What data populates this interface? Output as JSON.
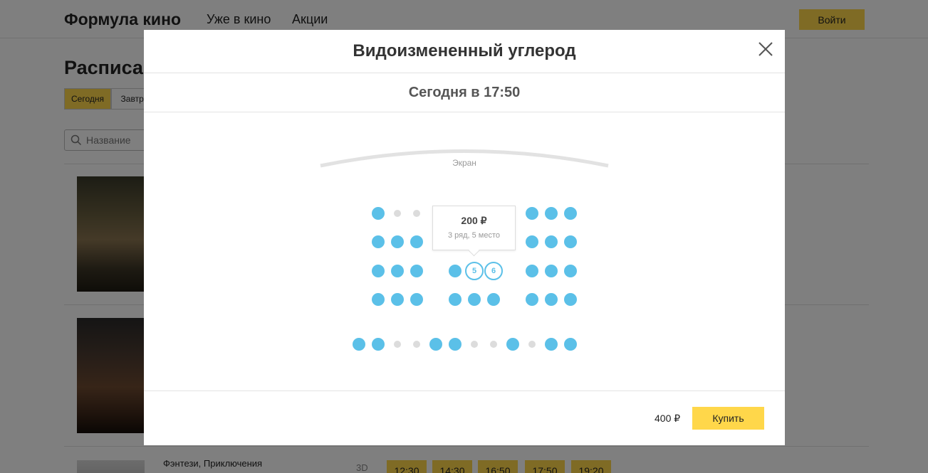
{
  "header": {
    "logo": "Формула кино",
    "nav": [
      "Уже в кино",
      "Акции"
    ],
    "login_label": "Войти"
  },
  "schedule": {
    "title": "Расписание",
    "day_tabs": [
      "Сегодня",
      "Завтра"
    ],
    "search_placeholder": "Название",
    "genre": "Фэнтези, Приключения",
    "format": "3D",
    "times": [
      "12:30",
      "14:30",
      "16:50",
      "17:50",
      "19:20"
    ]
  },
  "modal": {
    "title": "Видоизмененный углерод",
    "session": "Сегодня в 17:50",
    "screen_label": "Экран",
    "rows": [
      [
        "free",
        "taken",
        "taken",
        "gap",
        "free",
        "free",
        "free",
        "gap",
        "free",
        "free",
        "free"
      ],
      [
        "free",
        "free",
        "free",
        "gap",
        "free",
        "free",
        "free",
        "gap",
        "free",
        "free",
        "free"
      ],
      [
        "free",
        "free",
        "free",
        "gap",
        "free",
        "selected",
        "selected",
        "gap",
        "free",
        "free",
        "free"
      ],
      [
        "free",
        "free",
        "free",
        "gap",
        "free",
        "free",
        "free",
        "gap",
        "free",
        "free",
        "free"
      ],
      [
        "free",
        "free",
        "taken",
        "taken",
        "free",
        "free",
        "taken",
        "taken",
        "free",
        "taken",
        "free",
        "free"
      ]
    ],
    "selected_labels": [
      "5",
      "6"
    ],
    "tooltip": {
      "price": "200 ₽",
      "place": "3 ряд, 5 место"
    },
    "total": "400 ₽",
    "buy_label": "Купить"
  },
  "colors": {
    "accent": "#ffd74a",
    "seat_free": "#5bc0e8",
    "seat_taken": "#dcdcdc"
  }
}
